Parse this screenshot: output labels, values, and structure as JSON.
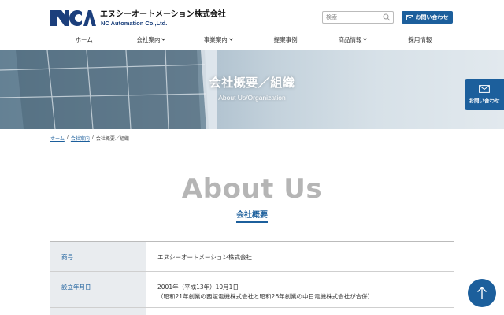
{
  "header": {
    "company_name_ja": "エヌシーオートメーション株式会社",
    "company_name_en": "NC Automation Co.,Ltd.",
    "search_placeholder": "検索",
    "contact_label": "お問い合わせ"
  },
  "nav": {
    "items": [
      {
        "label": "ホーム",
        "has_dropdown": false
      },
      {
        "label": "会社案内",
        "has_dropdown": true
      },
      {
        "label": "事業案内",
        "has_dropdown": true
      },
      {
        "label": "提案事例",
        "has_dropdown": false
      },
      {
        "label": "商品情報",
        "has_dropdown": true
      },
      {
        "label": "採用情報",
        "has_dropdown": false
      }
    ]
  },
  "hero": {
    "title": "会社概要／組織",
    "subtitle": "About Us/Organization"
  },
  "floating_contact": {
    "label": "お問い合わせ"
  },
  "breadcrumb": {
    "items": [
      "ホーム",
      "会社案内",
      "会社概要／組織"
    ],
    "separator": "/"
  },
  "section": {
    "title_en": "About Us",
    "title_ja": "会社概要"
  },
  "company_table": {
    "rows": [
      {
        "label": "商号",
        "value": "エヌシーオートメーション株式会社",
        "value2": ""
      },
      {
        "label": "設立年月日",
        "value": "2001年（平成13年）10月1日",
        "value2": "（昭和21年創業の西垣電機株式会社と昭和26年創業の中日電機株式会社が合併）"
      },
      {
        "label": "",
        "value": "",
        "value2": ""
      }
    ]
  },
  "colors": {
    "accent": "#1c5f9c",
    "heading_gray": "#b5b5b5",
    "table_header_bg": "#e9ecef"
  },
  "icons": {
    "search": "search-icon",
    "mail": "mail-icon",
    "chevron": "chevron-down-icon",
    "arrow_up": "arrow-up-icon"
  }
}
